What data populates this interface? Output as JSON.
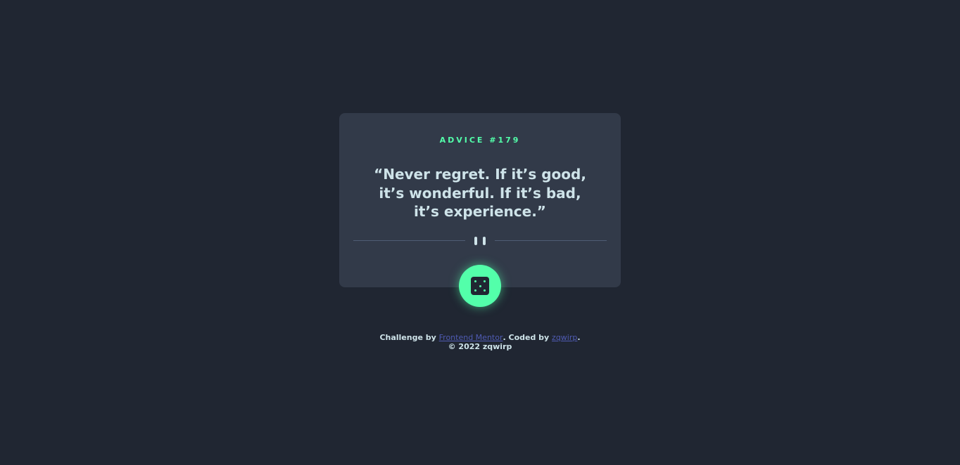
{
  "card": {
    "advice_label": "ADVICE #179",
    "quote": "“Never regret. If it’s good, it’s wonderful. If it’s bad, it’s experience.”"
  },
  "divider": {
    "icon": "pause-icon"
  },
  "dice_button": {
    "icon": "dice-icon"
  },
  "footer": {
    "challenge_prefix": "Challenge by ",
    "challenge_link": "Frontend Mentor",
    "coded_prefix": ". Coded by ",
    "coded_link": "zqwirp",
    "coded_suffix": ".",
    "copyright": "© 2022 zqwirp"
  },
  "colors": {
    "background": "#202632",
    "card": "#323a49",
    "accent": "#53ffaa",
    "text": "#cee3e9",
    "link": "#4f5bb3"
  }
}
